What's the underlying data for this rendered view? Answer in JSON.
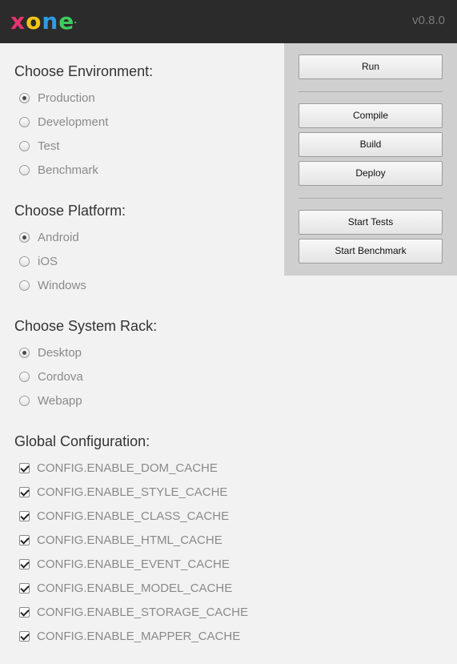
{
  "header": {
    "logo_letters": [
      "x",
      "o",
      "n",
      "e",
      "."
    ],
    "logo_colors": [
      "#e8336e",
      "#f5c518",
      "#2f9be8",
      "#3dcc5b",
      "#3dcc5b"
    ],
    "version": "v0.8.0",
    "background": "#2b2b2b"
  },
  "actions": {
    "run": "Run",
    "compile": "Compile",
    "build": "Build",
    "deploy": "Deploy",
    "start_tests": "Start Tests",
    "start_benchmark": "Start Benchmark"
  },
  "environment": {
    "title": "Choose Environment:",
    "selected": "Production",
    "options": [
      "Production",
      "Development",
      "Test",
      "Benchmark"
    ]
  },
  "platform": {
    "title": "Choose Platform:",
    "selected": "Android",
    "options": [
      "Android",
      "iOS",
      "Windows"
    ]
  },
  "rack": {
    "title": "Choose System Rack:",
    "selected": "Desktop",
    "options": [
      "Desktop",
      "Cordova",
      "Webapp"
    ]
  },
  "config": {
    "title": "Global Configuration:",
    "items": [
      {
        "label": "CONFIG.ENABLE_DOM_CACHE",
        "checked": true
      },
      {
        "label": "CONFIG.ENABLE_STYLE_CACHE",
        "checked": true
      },
      {
        "label": "CONFIG.ENABLE_CLASS_CACHE",
        "checked": true
      },
      {
        "label": "CONFIG.ENABLE_HTML_CACHE",
        "checked": true
      },
      {
        "label": "CONFIG.ENABLE_EVENT_CACHE",
        "checked": true
      },
      {
        "label": "CONFIG.ENABLE_MODEL_CACHE",
        "checked": true
      },
      {
        "label": "CONFIG.ENABLE_STORAGE_CACHE",
        "checked": true
      },
      {
        "label": "CONFIG.ENABLE_MAPPER_CACHE",
        "checked": true
      }
    ]
  }
}
